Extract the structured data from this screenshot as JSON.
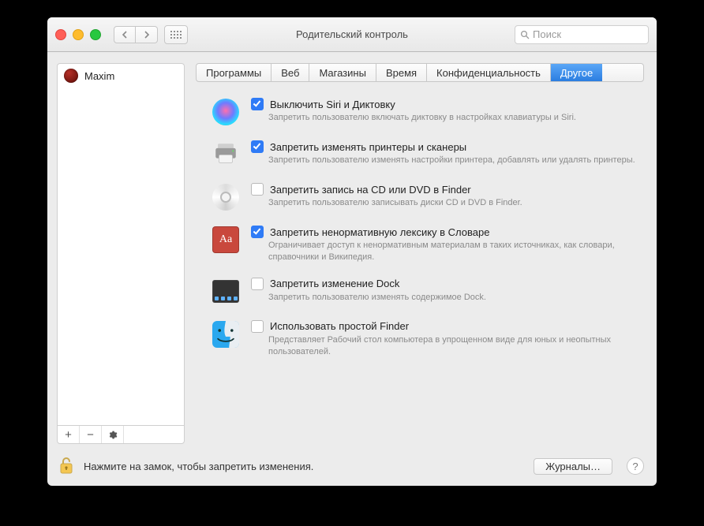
{
  "window": {
    "title": "Родительский контроль"
  },
  "search": {
    "placeholder": "Поиск"
  },
  "sidebar": {
    "users": [
      {
        "name": "Maxim"
      }
    ],
    "tools": {
      "add": "+",
      "remove": "−",
      "settings": "gear"
    }
  },
  "tabs": [
    {
      "label": "Программы",
      "active": false
    },
    {
      "label": "Веб",
      "active": false
    },
    {
      "label": "Магазины",
      "active": false
    },
    {
      "label": "Время",
      "active": false
    },
    {
      "label": "Конфиденциальность",
      "active": false
    },
    {
      "label": "Другое",
      "active": true
    }
  ],
  "options": [
    {
      "icon": "siri",
      "checked": true,
      "title": "Выключить Siri и Диктовку",
      "desc": "Запретить пользователю включать диктовку в настройках клавиатуры и Siri."
    },
    {
      "icon": "printer",
      "checked": true,
      "title": "Запретить изменять принтеры и сканеры",
      "desc": "Запретить пользователю изменять настройки принтера, добавлять или удалять принтеры."
    },
    {
      "icon": "cd",
      "checked": false,
      "title": "Запретить запись на CD или DVD в Finder",
      "desc": "Запретить пользователю записывать диски CD и DVD в Finder."
    },
    {
      "icon": "dict",
      "checked": true,
      "title": "Запретить ненормативную лексику в Словаре",
      "desc": "Ограничивает доступ к ненормативным материалам в таких источниках, как словари, справочники и Википедия."
    },
    {
      "icon": "dock",
      "checked": false,
      "title": "Запретить изменение Dock",
      "desc": "Запретить пользователю изменять содержимое Dock."
    },
    {
      "icon": "finder",
      "checked": false,
      "title": "Использовать простой Finder",
      "desc": "Представляет Рабочий стол компьютера в упрощенном виде для юных и неопытных пользователей."
    }
  ],
  "footer": {
    "lock_text": "Нажмите на замок, чтобы запретить изменения.",
    "logs_button": "Журналы…"
  },
  "dict_glyph": "Aa"
}
